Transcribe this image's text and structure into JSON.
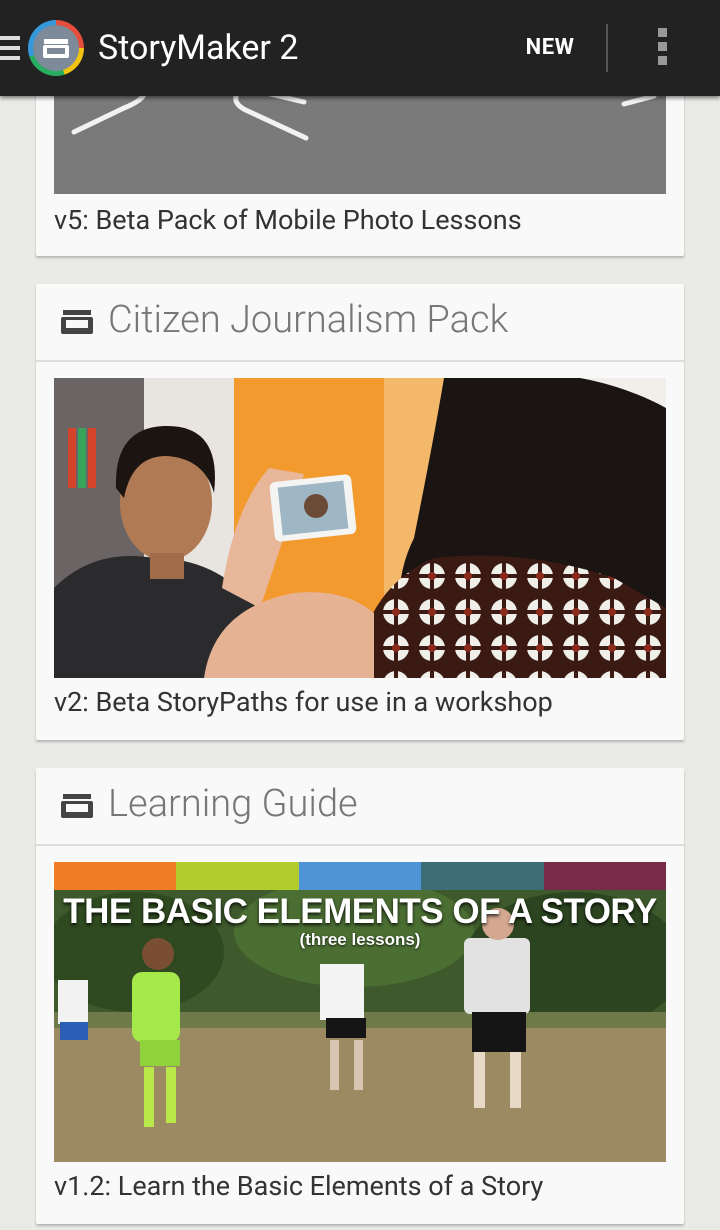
{
  "app": {
    "title": "StoryMaker 2",
    "new_label": "NEW"
  },
  "cards": [
    {
      "title": "",
      "caption": "v5: Beta Pack of Mobile Photo Lessons"
    },
    {
      "title": "Citizen Journalism Pack",
      "caption": "v2: Beta StoryPaths for use in a workshop"
    },
    {
      "title": "Learning Guide",
      "caption": "v1.2: Learn the Basic Elements of a Story",
      "banner": {
        "headline": "THE BASIC ELEMENTS OF A STORY",
        "subline": "(three lessons)",
        "stripe_colors": [
          "#f07d26",
          "#b3cc2e",
          "#4f95d6",
          "#3d6d77",
          "#7a2a49"
        ]
      }
    }
  ],
  "icons": {
    "menu": "hamburger-icon",
    "app": "storymaker-app-icon",
    "overflow": "overflow-menu-icon",
    "pack": "pack-box-icon"
  }
}
